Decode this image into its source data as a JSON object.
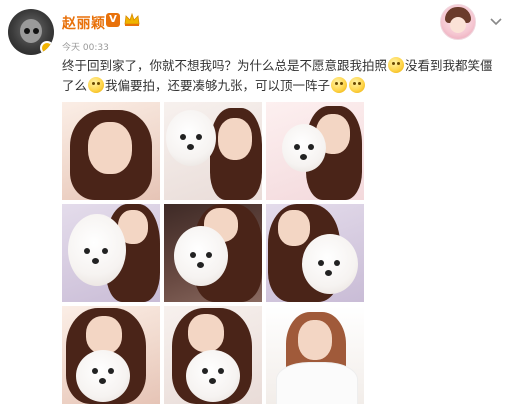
{
  "user": {
    "name": "赵丽颖",
    "verified_badge": "V",
    "timestamp": "今天 00:33"
  },
  "post": {
    "text_part1": "终于回到家了，你就不想我吗？为什么总是不愿意跟我拍照",
    "text_part2": "没看到我都笑僵了么",
    "text_part3": "我偏要拍，还要凑够九张，可以顶一阵子"
  },
  "icons": {
    "avatar": "avatar-icon",
    "crown": "crown-icon",
    "chevron": "chevron-down-icon",
    "emoji": "emoji-icon"
  },
  "colors": {
    "name_orange": "#e8710a",
    "meta_gray": "#999999",
    "text": "#333333"
  },
  "photos": [
    {
      "label": "photo-1"
    },
    {
      "label": "photo-2"
    },
    {
      "label": "photo-3"
    },
    {
      "label": "photo-4"
    },
    {
      "label": "photo-5"
    },
    {
      "label": "photo-6"
    },
    {
      "label": "photo-7"
    },
    {
      "label": "photo-8"
    },
    {
      "label": "photo-9"
    }
  ]
}
